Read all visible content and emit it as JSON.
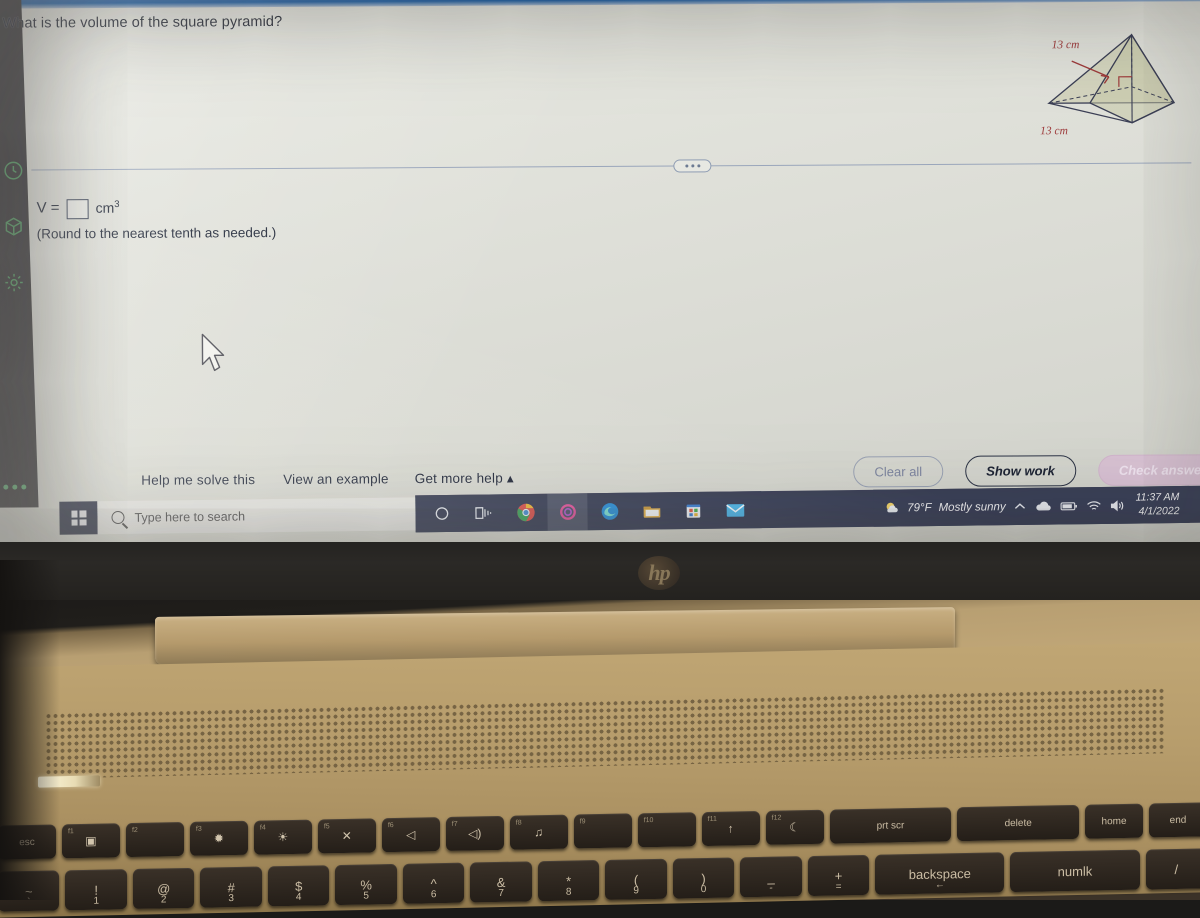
{
  "app": {
    "question": "What is the volume of the square pyramid?",
    "answer_prefix": "V =",
    "answer_value": "",
    "answer_unit": "cm",
    "answer_unit_exp": "3",
    "round_note": "(Round to the nearest tenth as needed.)",
    "figure": {
      "shape": "square-pyramid",
      "slant_or_height_label": "13 cm",
      "base_label": "13 cm",
      "label_color": "#9d3b3b"
    },
    "help_links": [
      {
        "label": "Help me solve this",
        "name": "help-me-solve-this-link"
      },
      {
        "label": "View an example",
        "name": "view-an-example-link"
      },
      {
        "label": "Get more help ▴",
        "name": "get-more-help-link"
      }
    ],
    "buttons": {
      "clear_all": "Clear all",
      "show_work": "Show work",
      "check_answer": "Check answer"
    },
    "rail_icons": [
      {
        "name": "history-clock-icon"
      },
      {
        "name": "cube-3d-icon"
      },
      {
        "name": "gear-settings-icon"
      },
      {
        "name": "overflow-dots-icon"
      }
    ],
    "accent_color": "#4f9f62"
  },
  "taskbar": {
    "start_label": "Start",
    "search_placeholder": "Type here to search",
    "apps": [
      {
        "name": "cortana-icon",
        "label": "Cortana"
      },
      {
        "name": "task-view-icon",
        "label": "Task View"
      },
      {
        "name": "chrome-icon",
        "label": "Google Chrome"
      },
      {
        "name": "pink-app-icon",
        "label": "App",
        "active": true
      },
      {
        "name": "edge-icon",
        "label": "Microsoft Edge"
      },
      {
        "name": "file-explorer-icon",
        "label": "File Explorer"
      },
      {
        "name": "microsoft-store-icon",
        "label": "Microsoft Store"
      },
      {
        "name": "mail-icon",
        "label": "Mail"
      }
    ],
    "weather_temp": "79°F",
    "weather_desc": "Mostly sunny",
    "tray": [
      {
        "name": "show-hidden-icons-icon"
      },
      {
        "name": "onedrive-cloud-icon"
      },
      {
        "name": "battery-icon"
      },
      {
        "name": "wifi-icon"
      },
      {
        "name": "volume-icon"
      }
    ],
    "time": "11:37 AM",
    "date": "4/1/2022"
  },
  "hardware": {
    "brand": "hp",
    "fn_keys": [
      {
        "label": "esc",
        "fn": "",
        "glyph": ""
      },
      {
        "label": "",
        "fn": "f1",
        "glyph": "▣"
      },
      {
        "label": "",
        "fn": "f2",
        "glyph": ""
      },
      {
        "label": "",
        "fn": "f3",
        "glyph": "✹"
      },
      {
        "label": "",
        "fn": "f4",
        "glyph": "☀"
      },
      {
        "label": "",
        "fn": "f5",
        "glyph": "✕"
      },
      {
        "label": "",
        "fn": "f6",
        "glyph": "◁"
      },
      {
        "label": "",
        "fn": "f7",
        "glyph": "◁)"
      },
      {
        "label": "",
        "fn": "f8",
        "glyph": "♫"
      },
      {
        "label": "",
        "fn": "f9",
        "glyph": ""
      },
      {
        "label": "",
        "fn": "f10",
        "glyph": ""
      },
      {
        "label": "",
        "fn": "f11",
        "glyph": "↑"
      },
      {
        "label": "",
        "fn": "f12",
        "glyph": "☾"
      },
      {
        "label": "prt scr",
        "fn": "",
        "glyph": ""
      },
      {
        "label": "delete",
        "fn": "",
        "glyph": ""
      },
      {
        "label": "home",
        "fn": "",
        "glyph": ""
      },
      {
        "label": "end",
        "fn": "",
        "glyph": ""
      }
    ],
    "num_keys": [
      {
        "top": "~",
        "bottom": "`"
      },
      {
        "top": "!",
        "bottom": "1"
      },
      {
        "top": "@",
        "bottom": "2"
      },
      {
        "top": "#",
        "bottom": "3"
      },
      {
        "top": "$",
        "bottom": "4"
      },
      {
        "top": "%",
        "bottom": "5"
      },
      {
        "top": "^",
        "bottom": "6"
      },
      {
        "top": "&",
        "bottom": "7"
      },
      {
        "top": "*",
        "bottom": "8"
      },
      {
        "top": "(",
        "bottom": "9"
      },
      {
        "top": ")",
        "bottom": "0"
      },
      {
        "top": "_",
        "bottom": "-"
      },
      {
        "top": "+",
        "bottom": "="
      },
      {
        "top": "backspace",
        "bottom": "←"
      },
      {
        "top": "numlk",
        "bottom": ""
      },
      {
        "top": "/",
        "bottom": ""
      }
    ]
  }
}
